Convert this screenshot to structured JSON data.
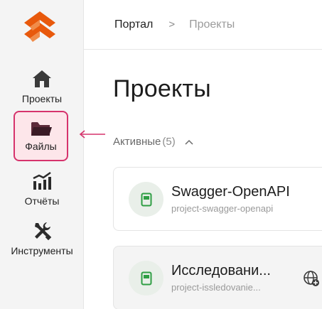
{
  "sidebar": {
    "items": [
      {
        "label": "Проекты",
        "icon": "home-icon"
      },
      {
        "label": "Файлы",
        "icon": "folder-icon"
      },
      {
        "label": "Отчёты",
        "icon": "chart-icon"
      },
      {
        "label": "Инструменты",
        "icon": "tools-icon"
      }
    ]
  },
  "breadcrumb": {
    "items": [
      "Портал",
      "Проекты"
    ],
    "separator": ">"
  },
  "page": {
    "title": "Проекты"
  },
  "section": {
    "name": "Активные",
    "count": "(5)"
  },
  "projects": [
    {
      "title": "Swagger-OpenAPI",
      "slug": "project-swagger-openapi"
    },
    {
      "title": "Исследовани...",
      "slug": "project-issledovanie..."
    }
  ],
  "colors": {
    "accent_pink": "#d6336c",
    "logo_orange": "#e8590c",
    "doc_green": "#2f9e44"
  }
}
